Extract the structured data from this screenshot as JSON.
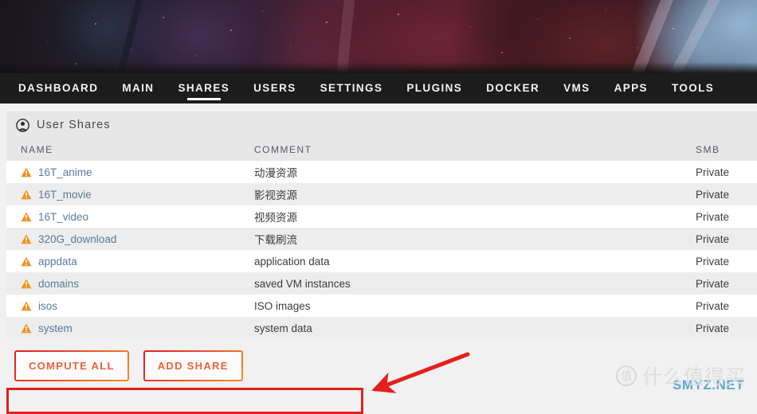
{
  "nav": {
    "items": [
      {
        "label": "DASHBOARD",
        "active": false
      },
      {
        "label": "MAIN",
        "active": false
      },
      {
        "label": "SHARES",
        "active": true
      },
      {
        "label": "USERS",
        "active": false
      },
      {
        "label": "SETTINGS",
        "active": false
      },
      {
        "label": "PLUGINS",
        "active": false
      },
      {
        "label": "DOCKER",
        "active": false
      },
      {
        "label": "VMS",
        "active": false
      },
      {
        "label": "APPS",
        "active": false
      },
      {
        "label": "TOOLS",
        "active": false
      }
    ]
  },
  "panel": {
    "title": "User Shares",
    "icon": "user-circle-icon"
  },
  "table": {
    "columns": [
      "NAME",
      "COMMENT",
      "SMB"
    ],
    "rows": [
      {
        "name": "16T_anime",
        "comment": "动漫资源",
        "smb": "Private",
        "icon": "warning-triangle-icon"
      },
      {
        "name": "16T_movie",
        "comment": "影视资源",
        "smb": "Private",
        "icon": "warning-triangle-icon"
      },
      {
        "name": "16T_video",
        "comment": "视频资源",
        "smb": "Private",
        "icon": "warning-triangle-icon"
      },
      {
        "name": "320G_download",
        "comment": "下载刷流",
        "smb": "Private",
        "icon": "warning-triangle-icon"
      },
      {
        "name": "appdata",
        "comment": "application data",
        "smb": "Private",
        "icon": "warning-triangle-icon"
      },
      {
        "name": "domains",
        "comment": "saved VM instances",
        "smb": "Private",
        "icon": "warning-triangle-icon"
      },
      {
        "name": "isos",
        "comment": "ISO images",
        "smb": "Private",
        "icon": "warning-triangle-icon"
      },
      {
        "name": "system",
        "comment": "system data",
        "smb": "Private",
        "icon": "warning-triangle-icon"
      }
    ]
  },
  "buttons": {
    "compute_all": "COMPUTE ALL",
    "add_share": "ADD SHARE"
  },
  "watermark": {
    "badge": "值",
    "text": "什么值得买",
    "site": "SMYZ.NET"
  },
  "colors": {
    "nav_bg": "#1c1c1c",
    "accent_warning": "#f0941e",
    "link": "#5b7a9a",
    "annotation": "#e3201b",
    "button_gradient_start": "#e01b24",
    "button_gradient_end": "#f6901f",
    "row_alt": "#ededed",
    "header_bg": "#e7e7e7"
  }
}
